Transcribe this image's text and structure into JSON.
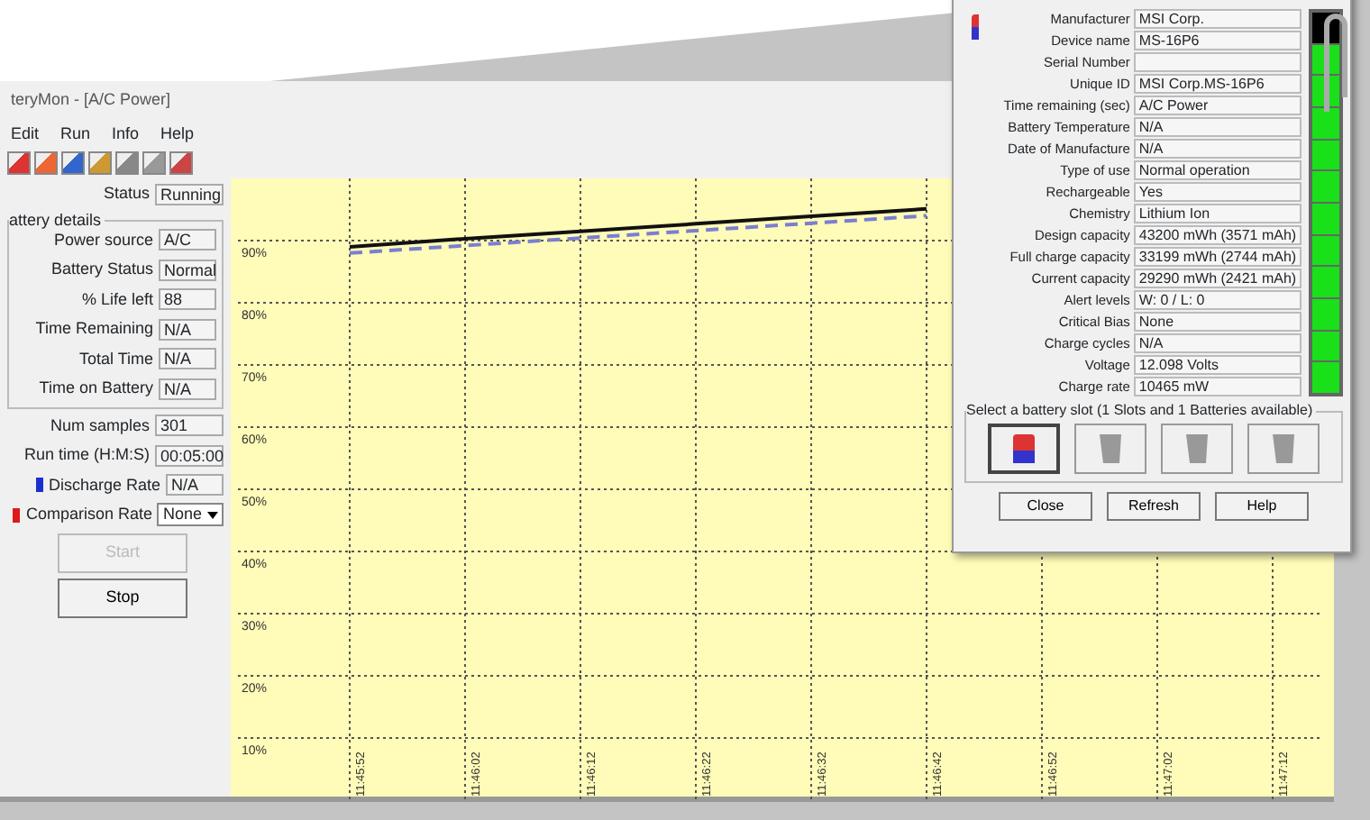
{
  "window": {
    "title": "teryMon - [A/C Power]"
  },
  "menu": [
    "Edit",
    "Run",
    "Info",
    "Help"
  ],
  "status": {
    "label": "Status",
    "value": "Running"
  },
  "battery_details": {
    "title": "attery details",
    "fields": [
      {
        "label": "Power source",
        "value": "A/C"
      },
      {
        "label": "Battery Status",
        "value": "Normal"
      },
      {
        "label": "% Life left",
        "value": "88"
      },
      {
        "label": "Time Remaining",
        "value": "N/A"
      },
      {
        "label": "Total Time",
        "value": "N/A"
      },
      {
        "label": "Time on Battery",
        "value": "N/A"
      }
    ]
  },
  "sampling": [
    {
      "label": "Num samples",
      "value": "301"
    },
    {
      "label": "Run time (H:M:S)",
      "value": "00:05:00"
    }
  ],
  "rates": [
    {
      "label": "Discharge Rate",
      "color": "#1a2fd0",
      "kind": "text",
      "value": "N/A"
    },
    {
      "label": "Comparison Rate",
      "color": "#e01818",
      "kind": "select",
      "value": "None"
    }
  ],
  "buttons": [
    {
      "label": "Start",
      "disabled": true
    },
    {
      "label": "Stop",
      "disabled": false
    }
  ],
  "chart": {
    "chart_data": {
      "type": "line",
      "categories": [
        "11:45:52",
        "11:46:02",
        "11:46:12",
        "11:46:22",
        "11:46:32",
        "11:46:42",
        "11:46:52",
        "11:47:02",
        "11:47:12"
      ],
      "yticks": [
        {
          "value": 90,
          "label": "90%"
        },
        {
          "value": 80,
          "label": "80%"
        },
        {
          "value": 70,
          "label": "70%"
        },
        {
          "value": 60,
          "label": "60%"
        },
        {
          "value": 50,
          "label": "50%"
        },
        {
          "value": 40,
          "label": "40%"
        },
        {
          "value": 30,
          "label": "30%"
        },
        {
          "value": 20,
          "label": "20%"
        },
        {
          "value": 10,
          "label": "10%"
        }
      ],
      "ylim": [
        0,
        100
      ],
      "grid": true,
      "series": [
        {
          "color": "#111111",
          "line_style": "solid",
          "values": [
            89,
            90.3,
            91.5,
            92.7,
            93.9,
            95.1,
            null,
            null,
            null
          ]
        },
        {
          "color": "#7a7fd0",
          "line_style": "dashed",
          "values": [
            88,
            89.2,
            90.4,
            91.6,
            92.8,
            94,
            null,
            null,
            null
          ]
        }
      ]
    }
  },
  "dialog": {
    "fields": [
      {
        "label": "Manufacturer",
        "value": "MSI Corp."
      },
      {
        "label": "Device name",
        "value": "MS-16P6"
      },
      {
        "label": "Serial Number"
      },
      {
        "label": "Unique ID",
        "value": "MSI Corp.MS-16P6"
      },
      {
        "label": "Time remaining (sec)",
        "value": "A/C Power"
      },
      {
        "label": "Battery Temperature",
        "value": "N/A"
      },
      {
        "label": "Date of Manufacture",
        "value": "N/A"
      },
      {
        "label": "Type of use",
        "value": "Normal operation"
      },
      {
        "label": "Rechargeable",
        "value": "Yes"
      },
      {
        "label": "Chemistry",
        "value": "Lithium Ion"
      },
      {
        "label": "Design capacity",
        "value": "43200 mWh (3571 mAh)"
      },
      {
        "label": "Full charge capacity",
        "value": "33199 mWh (2744 mAh)"
      },
      {
        "label": "Current capacity",
        "value": "29290 mWh (2421 mAh)"
      },
      {
        "label": "Alert levels",
        "value": "W: 0 / L: 0"
      },
      {
        "label": "Critical Bias",
        "value": "None"
      },
      {
        "label": "Charge cycles",
        "value": "N/A"
      },
      {
        "label": "Voltage",
        "value": "12.098 Volts"
      },
      {
        "label": "Charge rate",
        "value": "10465 mW"
      }
    ],
    "charge_meter": {
      "level": 0.88
    },
    "slots": {
      "title": "Select a battery slot (1 Slots and 1 Batteries available)",
      "items": [
        {
          "kind": "battery",
          "selected": true
        },
        {
          "kind": "empty",
          "selected": false
        },
        {
          "kind": "empty",
          "selected": false
        },
        {
          "kind": "empty",
          "selected": false
        }
      ]
    },
    "buttons": [
      "Close",
      "Refresh",
      "Help"
    ]
  }
}
